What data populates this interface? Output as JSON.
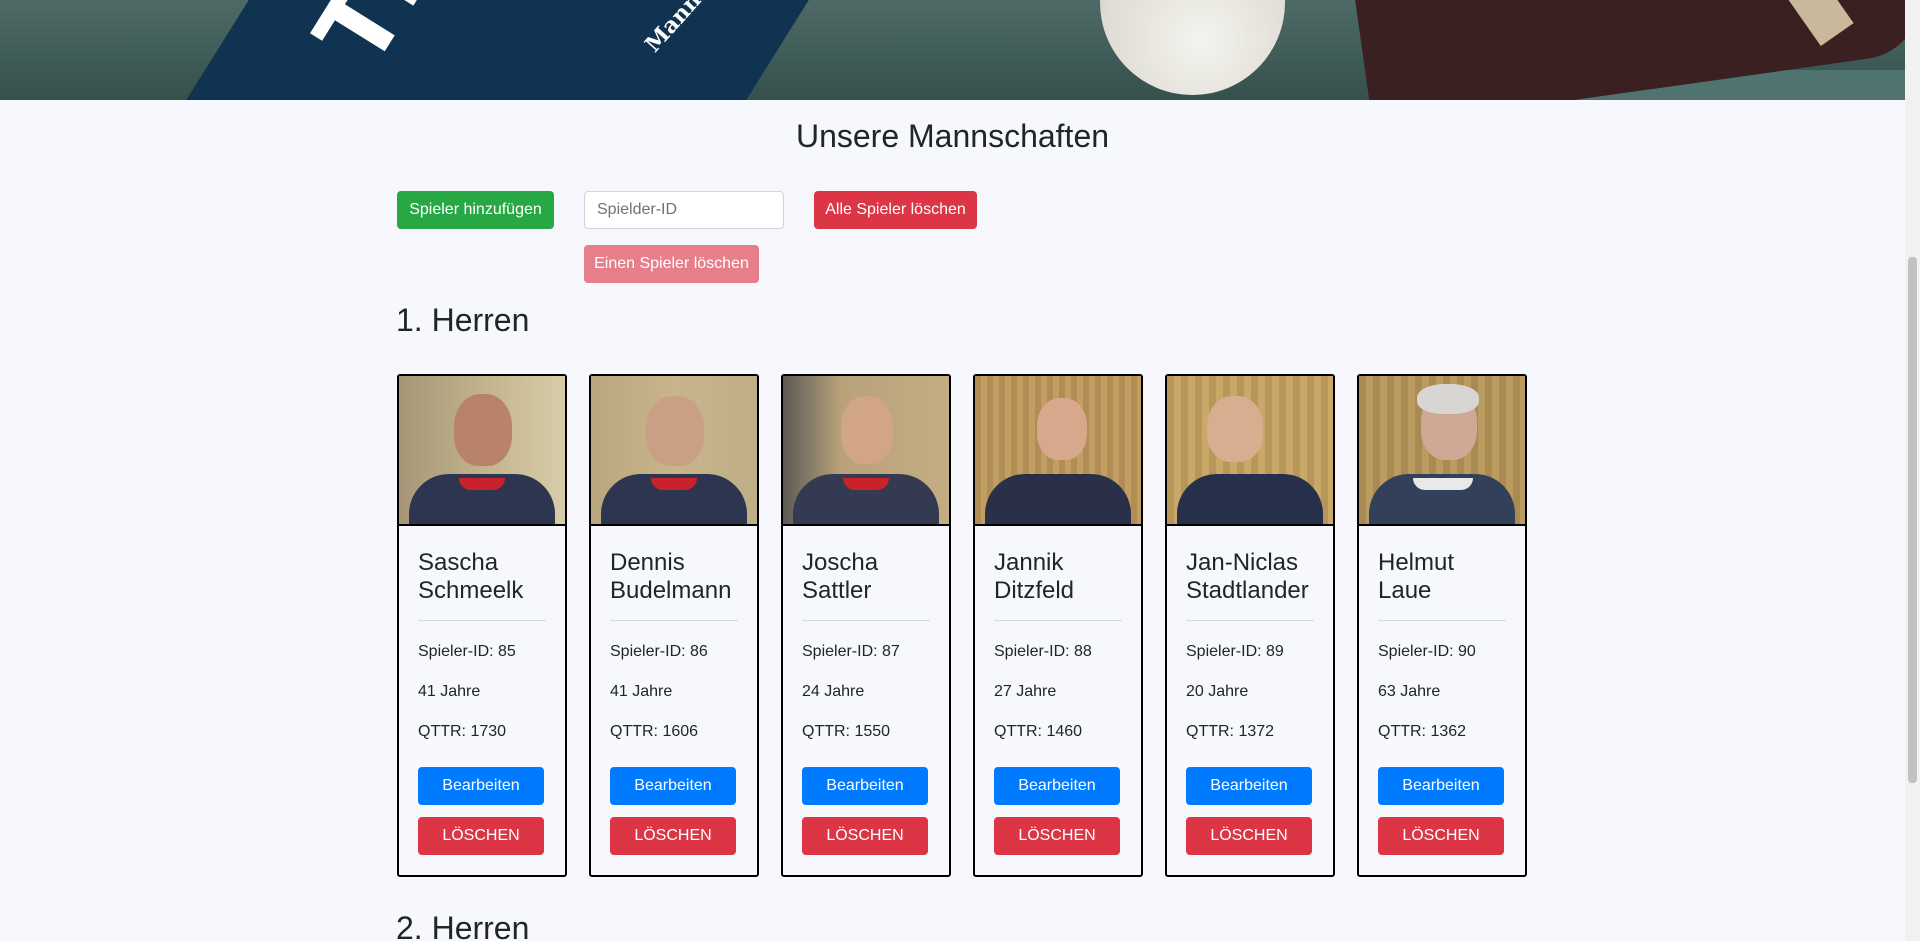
{
  "hero": {
    "banner_word": "Tisc",
    "banner_sub": "Mannscha"
  },
  "page": {
    "title": "Unsere Mannschaften"
  },
  "controls": {
    "add_player": "Spieler hinzufügen",
    "player_id_placeholder": "Spielder-ID",
    "delete_all": "Alle Spieler löschen",
    "delete_one": "Einen Spieler löschen"
  },
  "teams": [
    {
      "name": "1. Herren",
      "players": [
        {
          "name": "Sascha Schmeelk",
          "id_label": "Spieler-ID: 85",
          "age": "41 Jahre",
          "qttr": "QTTR: 1730",
          "edit": "Bearbeiten",
          "delete": "LÖSCHEN"
        },
        {
          "name": "Dennis Budelmann",
          "id_label": "Spieler-ID: 86",
          "age": "41 Jahre",
          "qttr": "QTTR: 1606",
          "edit": "Bearbeiten",
          "delete": "LÖSCHEN"
        },
        {
          "name": "Joscha Sattler",
          "id_label": "Spieler-ID: 87",
          "age": "24 Jahre",
          "qttr": "QTTR: 1550",
          "edit": "Bearbeiten",
          "delete": "LÖSCHEN"
        },
        {
          "name": "Jannik Ditzfeld",
          "id_label": "Spieler-ID: 88",
          "age": "27 Jahre",
          "qttr": "QTTR: 1460",
          "edit": "Bearbeiten",
          "delete": "LÖSCHEN"
        },
        {
          "name": "Jan-Niclas Stadtlander",
          "id_label": "Spieler-ID: 89",
          "age": "20 Jahre",
          "qttr": "QTTR: 1372",
          "edit": "Bearbeiten",
          "delete": "LÖSCHEN"
        },
        {
          "name": "Helmut Laue",
          "id_label": "Spieler-ID: 90",
          "age": "63 Jahre",
          "qttr": "QTTR: 1362",
          "edit": "Bearbeiten",
          "delete": "LÖSCHEN"
        }
      ]
    },
    {
      "name": "2. Herren",
      "players": []
    }
  ],
  "colors": {
    "add": "#28a745",
    "danger": "#dc3545",
    "danger_disabled": "#e77f8a",
    "primary": "#007bff",
    "background": "#f6f8fe"
  }
}
